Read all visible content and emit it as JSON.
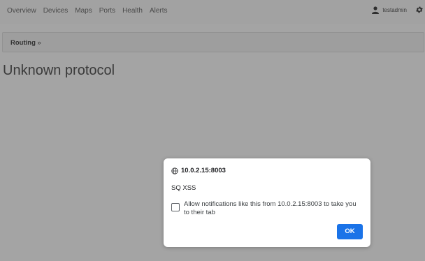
{
  "nav": {
    "items": [
      {
        "label": "Overview"
      },
      {
        "label": "Devices"
      },
      {
        "label": "Maps"
      },
      {
        "label": "Ports"
      },
      {
        "label": "Health"
      },
      {
        "label": "Alerts"
      }
    ],
    "username": "testadmin",
    "user_icon": "user-icon",
    "settings_icon": "gear-icon"
  },
  "breadcrumb": {
    "section": "Routing",
    "separator": "»"
  },
  "page": {
    "title": "Unknown protocol"
  },
  "dialog": {
    "origin": "10.0.2.15:8003",
    "origin_icon": "globe-icon",
    "message": "SQ XSS",
    "checkbox_label": "Allow notifications like this from 10.0.2.15:8003 to take you to their tab",
    "checkbox_checked": false,
    "ok_label": "OK",
    "accent_color": "#1a73e8"
  }
}
